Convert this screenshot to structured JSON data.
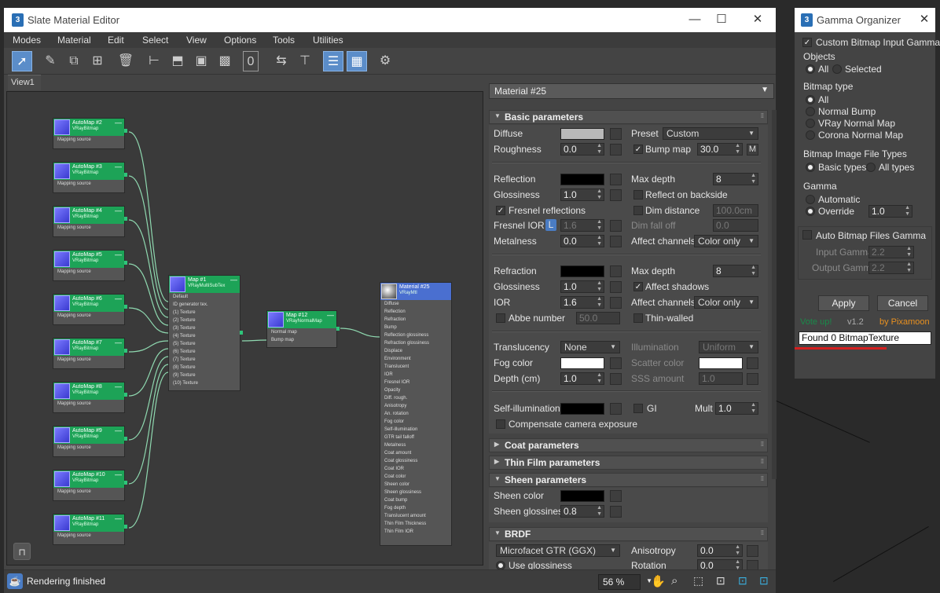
{
  "slate": {
    "title": "Slate Material Editor",
    "menu": [
      "Modes",
      "Material",
      "Edit",
      "Select",
      "View",
      "Options",
      "Tools",
      "Utilities"
    ],
    "view_tab": "View1",
    "toolbar_numeric": "0",
    "material_dropdown": "Material #25",
    "status_text": "Rendering finished",
    "zoom_value": "56 %"
  },
  "nodes": {
    "automaps": [
      {
        "name": "AutoMap #2",
        "type": "VRayBitmap",
        "slot": "Mapping source"
      },
      {
        "name": "AutoMap #3",
        "type": "VRayBitmap",
        "slot": "Mapping source"
      },
      {
        "name": "AutoMap #4",
        "type": "VRayBitmap",
        "slot": "Mapping source"
      },
      {
        "name": "AutoMap #5",
        "type": "VRayBitmap",
        "slot": "Mapping source"
      },
      {
        "name": "AutoMap #6",
        "type": "VRayBitmap",
        "slot": "Mapping source"
      },
      {
        "name": "AutoMap #7",
        "type": "VRayBitmap",
        "slot": "Mapping source"
      },
      {
        "name": "AutoMap #8",
        "type": "VRayBitmap",
        "slot": "Mapping source"
      },
      {
        "name": "AutoMap #9",
        "type": "VRayBitmap",
        "slot": "Mapping source"
      },
      {
        "name": "AutoMap #10",
        "type": "VRayBitmap",
        "slot": "Mapping source"
      },
      {
        "name": "AutoMap #11",
        "type": "VRayBitmap",
        "slot": "Mapping source"
      }
    ],
    "multisub": {
      "name": "Map #1",
      "type": "VRayMultiSubTex",
      "rows": [
        "Default",
        "ID generator tex.",
        "(1) Texture",
        "(2) Texture",
        "(3) Texture",
        "(4) Texture",
        "(5) Texture",
        "(6) Texture",
        "(7) Texture",
        "(8) Texture",
        "(9) Texture",
        "(10) Texture"
      ]
    },
    "normalmap": {
      "name": "Map #12",
      "type": "VRayNormalMap",
      "rows": [
        "Normal map",
        "Bump map"
      ]
    },
    "material": {
      "name": "Material #25",
      "type": "VRayMtl",
      "rows": [
        "Diffuse",
        "Reflection",
        "Refraction",
        "Bump",
        "Reflection glossiness",
        "Refraction glossiness",
        "Displace",
        "Environment",
        "Translucent",
        "IOR",
        "Fresnel IOR",
        "Opacity",
        "Diff. rough.",
        "Anisotropy",
        "An. rotation",
        "Fog color",
        "Self-illumination",
        "GTR tail falloff",
        "Metalness",
        "Coat amount",
        "Coat glossiness",
        "Coat IOR",
        "Coat color",
        "Sheen color",
        "Sheen glossiness",
        "Coat bump",
        "Fog depth",
        "Translucent amount",
        "Thin Film Thickness",
        "Thin Film IOR"
      ]
    }
  },
  "params": {
    "basic_header": "Basic parameters",
    "diffuse": "Diffuse",
    "preset_label": "Preset",
    "preset_value": "Custom",
    "roughness": "Roughness",
    "roughness_value": "0.0",
    "bump_map": "Bump map",
    "bump_value": "30.0",
    "bump_m": "M",
    "reflection": "Reflection",
    "max_depth": "Max depth",
    "max_depth_value": "8",
    "glossiness": "Glossiness",
    "glossiness_value": "1.0",
    "reflect_backside": "Reflect on backside",
    "fresnel_reflections": "Fresnel reflections",
    "dim_distance": "Dim distance",
    "dim_distance_value": "100.0cm",
    "fresnel_ior": "Fresnel IOR",
    "fresnel_l": "L",
    "fresnel_ior_value": "1.6",
    "dim_fall_off": "Dim fall off",
    "dim_fall_off_value": "0.0",
    "metalness": "Metalness",
    "metalness_value": "0.0",
    "affect_channels": "Affect channels",
    "color_only": "Color only",
    "refraction": "Refraction",
    "refr_max_depth_value": "8",
    "refr_glossiness_value": "1.0",
    "affect_shadows": "Affect shadows",
    "ior": "IOR",
    "ior_value": "1.6",
    "abbe_number": "Abbe number",
    "abbe_value": "50.0",
    "thin_walled": "Thin-walled",
    "translucency": "Translucency",
    "translucency_value": "None",
    "illumination": "Illumination",
    "illumination_value": "Uniform",
    "fog_color": "Fog color",
    "scatter_color": "Scatter color",
    "depth_cm": "Depth (cm)",
    "depth_value": "1.0",
    "sss_amount": "SSS amount",
    "sss_value": "1.0",
    "self_illumination": "Self-illumination",
    "gi": "GI",
    "mult": "Mult",
    "mult_value": "1.0",
    "compensate": "Compensate camera exposure",
    "coat_header": "Coat parameters",
    "thinfilm_header": "Thin Film parameters",
    "sheen_header": "Sheen parameters",
    "sheen_color": "Sheen color",
    "sheen_glossiness": "Sheen glossiness",
    "sheen_gloss_value": "0.8",
    "brdf_header": "BRDF",
    "brdf_type": "Microfacet GTR (GGX)",
    "anisotropy": "Anisotropy",
    "anisotropy_value": "0.0",
    "use_glossiness": "Use glossiness",
    "rotation": "Rotation",
    "rotation_value": "0.0"
  },
  "gamma": {
    "title": "Gamma Organizer",
    "custom_bitmap_input_gamma": "Custom Bitmap Input Gamma",
    "objects_label": "Objects",
    "all": "All",
    "selected": "Selected",
    "bitmap_type_label": "Bitmap type",
    "bt_all": "All",
    "normal_bump": "Normal Bump",
    "vray_normal_map": "VRay Normal Map",
    "corona_normal_map": "Corona Normal Map",
    "file_types_label": "Bitmap Image File Types",
    "basic_types": "Basic types",
    "all_types": "All types",
    "gamma_label": "Gamma",
    "automatic": "Automatic",
    "override": "Override",
    "override_value": "1.0",
    "auto_bitmap_files_gamma": "Auto Bitmap Files Gamma",
    "input_gamma": "Input Gamma",
    "input_gamma_value": "2.2",
    "output_gamma": "Output Gamma",
    "output_gamma_value": "2.2",
    "apply": "Apply",
    "cancel": "Cancel",
    "vote_up": "Vote up!",
    "version": "v1.2",
    "by": "by Pixamoon",
    "found_text": "Found 0 BitmapTexture"
  },
  "colors": {
    "node_green": "#1da357",
    "node_blue": "#4a6fd0",
    "wire": "#8fd9b0",
    "vote_green": "#1a8a4a",
    "by_orange": "#e89020",
    "redline": "#d42020"
  }
}
